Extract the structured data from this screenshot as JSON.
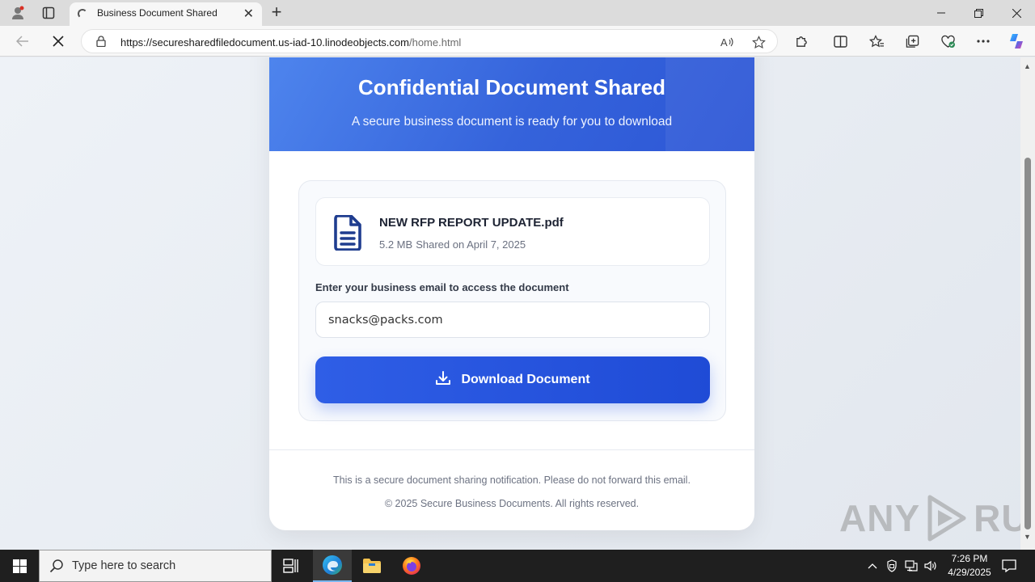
{
  "browser": {
    "tab_title": "Business Document Shared",
    "url_host": "https://securesharedfiledocument.us-iad-10.linodeobjects.com",
    "url_path": "/home.html"
  },
  "page": {
    "hero_title": "Confidential Document Shared",
    "hero_subtitle": "A secure business document is ready for you to download",
    "file_name": "NEW RFP REPORT UPDATE.pdf",
    "file_size": "5.2 MB",
    "file_shared": "Shared on April 7, 2025",
    "email_label": "Enter your business email to access the document",
    "email_value": "snacks@packs.com",
    "download_label": "Download Document",
    "footer_notice": "This is a secure document sharing notification. Please do not forward this email.",
    "footer_copyright": "© 2025 Secure Business Documents. All rights reserved."
  },
  "watermark": {
    "left": "ANY",
    "right": "RUN"
  },
  "taskbar": {
    "search_placeholder": "Type here to search",
    "time": "7:26 PM",
    "date": "4/29/2025"
  },
  "colors": {
    "hero_start": "#4f86ee",
    "hero_end": "#2c56d6",
    "button": "#2f5ee6",
    "file_icon": "#1f3d8f"
  }
}
